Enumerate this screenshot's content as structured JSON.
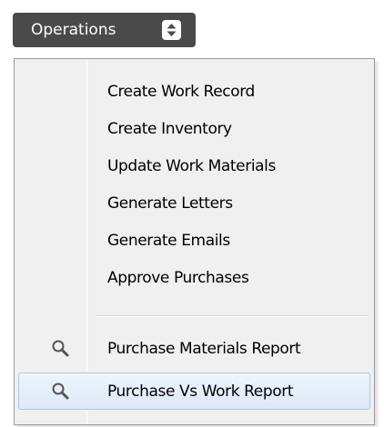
{
  "operations_button": {
    "label": "Operations",
    "stepper_icon": "up-down-stepper-icon"
  },
  "menu": {
    "items": [
      {
        "label": "Create Work Record",
        "icon": ""
      },
      {
        "label": "Create Inventory",
        "icon": ""
      },
      {
        "label": "Update Work Materials",
        "icon": ""
      },
      {
        "label": "Generate Letters",
        "icon": ""
      },
      {
        "label": "Generate Emails",
        "icon": ""
      },
      {
        "label": "Approve Purchases",
        "icon": ""
      },
      {
        "label": "Purchase Materials Report",
        "icon": "magnifier-icon"
      },
      {
        "label": "Purchase Vs Work Report",
        "icon": "magnifier-icon",
        "hovered": true
      }
    ]
  },
  "colors": {
    "button_bg": "#4a4a4a",
    "menu_bg": "#f0f0f0",
    "hover_bg": "#dce9f7",
    "hover_border": "#aac8ea"
  }
}
